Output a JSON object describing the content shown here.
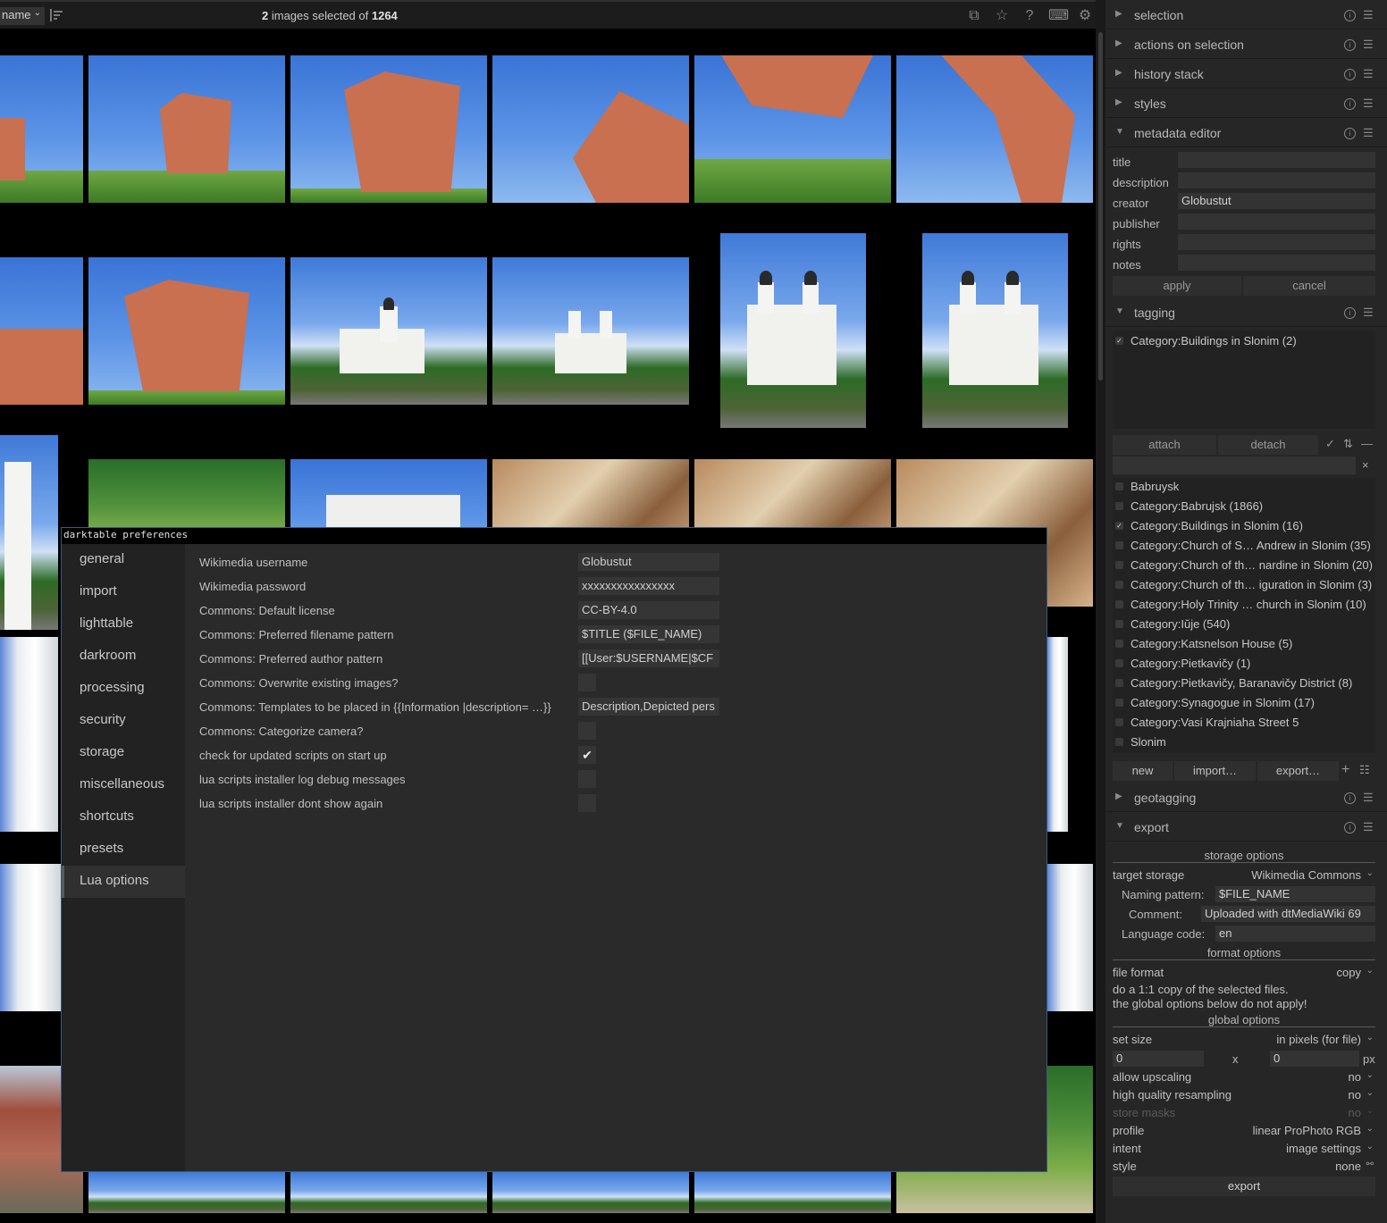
{
  "topbar": {
    "sort_value": "name",
    "selection_prefix": "2",
    "selection_middle": " images selected of ",
    "selection_total": "1264"
  },
  "right_panel": {
    "modules_top": [
      {
        "label": "selection",
        "expanded": false
      },
      {
        "label": "actions on selection",
        "expanded": false
      },
      {
        "label": "history stack",
        "expanded": false
      },
      {
        "label": "styles",
        "expanded": false
      },
      {
        "label": "metadata editor",
        "expanded": true
      }
    ],
    "metadata": {
      "fields": [
        {
          "label": "title",
          "value": ""
        },
        {
          "label": "description",
          "value": ""
        },
        {
          "label": "creator",
          "value": "Globustut"
        },
        {
          "label": "publisher",
          "value": ""
        },
        {
          "label": "rights",
          "value": ""
        },
        {
          "label": "notes",
          "value": ""
        }
      ],
      "apply": "apply",
      "cancel": "cancel"
    },
    "tagging": {
      "header": "tagging",
      "attached": [
        {
          "label": "Category:Buildings in Slonim (2)",
          "checked": true
        }
      ],
      "attach": "attach",
      "detach": "detach",
      "search_value": "",
      "dictionary": [
        {
          "label": "Babruysk",
          "checked": false
        },
        {
          "label": "Category:Babrujsk (1866)",
          "checked": false
        },
        {
          "label": "Category:Buildings in Slonim (16)",
          "checked": true
        },
        {
          "label": "Category:Church of S… Andrew in Slonim (35)",
          "checked": false
        },
        {
          "label": "Category:Church of th… nardine in Slonim (20)",
          "checked": false
        },
        {
          "label": "Category:Church of th… iguration in Slonim (3)",
          "checked": false
        },
        {
          "label": "Category:Holy Trinity … church in Slonim (10)",
          "checked": false
        },
        {
          "label": "Category:Iŭje (540)",
          "checked": false
        },
        {
          "label": "Category:Katsnelson House (5)",
          "checked": false
        },
        {
          "label": "Category:Pietkavičy (1)",
          "checked": false
        },
        {
          "label": "Category:Pietkavičy, Baranavičy District (8)",
          "checked": false
        },
        {
          "label": "Category:Synagogue in Slonim (17)",
          "checked": false
        },
        {
          "label": "Category:Vasi Krajniaha Street 5",
          "checked": false
        },
        {
          "label": "Slonim",
          "checked": false
        }
      ],
      "new": "new",
      "import": "import…",
      "export": "export…"
    },
    "geotagging": {
      "label": "geotagging"
    },
    "export": {
      "header": "export",
      "storage_options_title": "storage options",
      "target_storage_label": "target storage",
      "target_storage_value": "Wikimedia Commons",
      "naming_pattern_label": "Naming pattern:",
      "naming_pattern_value": "$FILE_NAME",
      "comment_label": "Comment:",
      "comment_value": "Uploaded with dtMediaWiki 69",
      "language_label": "Language code:",
      "language_value": "en",
      "format_options_title": "format options",
      "file_format_label": "file format",
      "file_format_value": "copy",
      "copy_note_1": "do a 1:1 copy of the selected files.",
      "copy_note_2": "the global options below do not apply!",
      "global_options_title": "global options",
      "set_size_label": "set size",
      "set_size_value": "in pixels (for file)",
      "width_value": "0",
      "x_sep": "x",
      "height_value": "0",
      "px_unit": "px",
      "allow_upscaling_label": "allow upscaling",
      "allow_upscaling_value": "no",
      "hq_resampling_label": "high quality resampling",
      "hq_resampling_value": "no",
      "store_masks_label": "store masks",
      "store_masks_value": "no",
      "profile_label": "profile",
      "profile_value": "linear ProPhoto RGB",
      "intent_label": "intent",
      "intent_value": "image settings",
      "style_label": "style",
      "style_value": "none",
      "export_button": "export"
    }
  },
  "dialog": {
    "title": "darktable preferences",
    "nav": [
      "general",
      "import",
      "lighttable",
      "darkroom",
      "processing",
      "security",
      "storage",
      "miscellaneous",
      "shortcuts",
      "presets",
      "Lua options"
    ],
    "active_nav": "Lua options",
    "prefs": [
      {
        "label": "Wikimedia username",
        "type": "text",
        "value": "Globustut"
      },
      {
        "label": "Wikimedia password",
        "type": "text",
        "value": "xxxxxxxxxxxxxxxx"
      },
      {
        "label": "Commons: Default license",
        "type": "text",
        "value": "CC-BY-4.0"
      },
      {
        "label": "Commons: Preferred filename pattern",
        "type": "text",
        "value": "$TITLE ($FILE_NAME)"
      },
      {
        "label": "Commons: Preferred author pattern",
        "type": "text",
        "value": "[[User:$USERNAME|$CF"
      },
      {
        "label": "Commons: Overwrite existing images?",
        "type": "check",
        "checked": false
      },
      {
        "label": "Commons: Templates to be placed in {{Information |description= …}}",
        "type": "text",
        "value": "Description,Depicted pers"
      },
      {
        "label": "Commons: Categorize camera?",
        "type": "check",
        "checked": false
      },
      {
        "label": "check for updated scripts on start up",
        "type": "check",
        "checked": true
      },
      {
        "label": "lua scripts installer log debug messages",
        "type": "check",
        "checked": false
      },
      {
        "label": "lua scripts installer dont show again",
        "type": "check",
        "checked": false
      }
    ]
  }
}
